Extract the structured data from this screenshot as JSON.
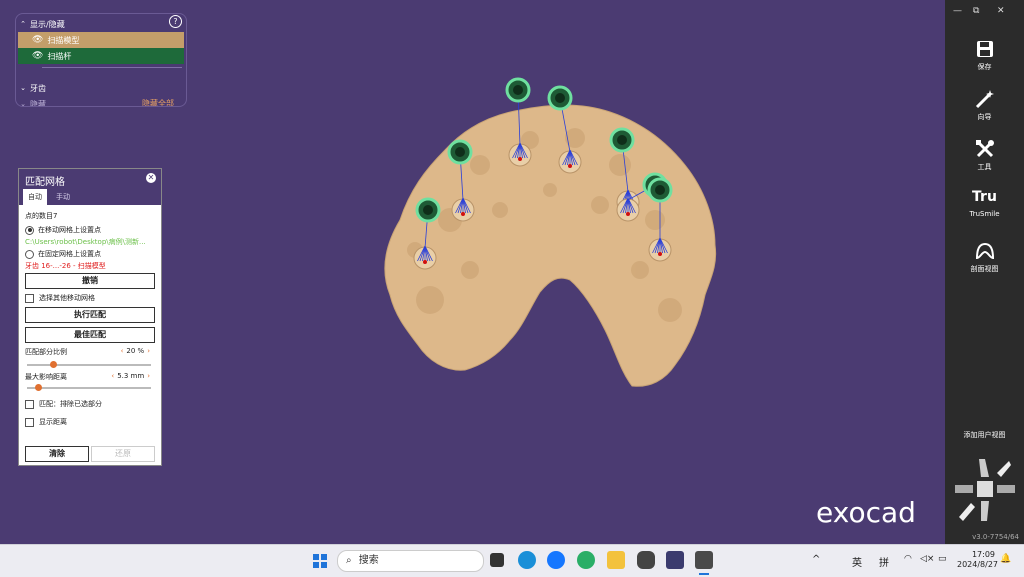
{
  "visibility_panel": {
    "header": "显示/隐藏",
    "help": "?",
    "items": [
      {
        "label": "扫描模型",
        "color": "#c49e6a"
      },
      {
        "label": "扫描杆",
        "color": "#1e6a3a"
      }
    ],
    "teeth": "牙齿",
    "hidden": "隐藏",
    "hide_all": "隐藏全部"
  },
  "match_panel": {
    "title": "匹配网格",
    "tabs": [
      "自动",
      "手动"
    ],
    "point_count": "点的数目7",
    "radio_moving": "在移动网格上设置点",
    "path": "C:\\Users\\robot\\Desktop\\病例\\测新...",
    "radio_fixed": "在固定网格上设置点",
    "tooth_info": "牙齿 16-...-26 - 扫描模型",
    "undo": "撤销",
    "select_other": "选择其他移动网格",
    "execute": "执行匹配",
    "best": "最佳匹配",
    "ratio_label": "匹配部分比例",
    "ratio_value": "20 %",
    "ratio_fraction": 0.2,
    "dist_label": "最大影响距离",
    "dist_value": "5.3 mm",
    "dist_fraction": 0.07,
    "exclude": "匹配：排除已选部分",
    "show_dist": "显示距离",
    "clear": "清除",
    "restore": "还原"
  },
  "sidebar": {
    "window_controls": [
      "—",
      "⧉",
      "✕"
    ],
    "tools": [
      {
        "label": "保存",
        "icon": "save-icon"
      },
      {
        "label": "向导",
        "icon": "wizard-wand-icon"
      },
      {
        "label": "工具",
        "icon": "tools-icon"
      },
      {
        "label": "TruSmile",
        "icon": "trusmile-icon"
      },
      {
        "label": "剖面视图",
        "icon": "section-view-icon"
      }
    ],
    "trusmile_glyph": "Tru",
    "add_view": "添加用户视图",
    "version": "v3.0-7754/64"
  },
  "logo": "exocad",
  "taskbar": {
    "search_placeholder": "搜索",
    "ime_lang": "英",
    "ime_mode": "拼",
    "time": "17:09",
    "date": "2024/8/27",
    "tray_up": "^"
  }
}
